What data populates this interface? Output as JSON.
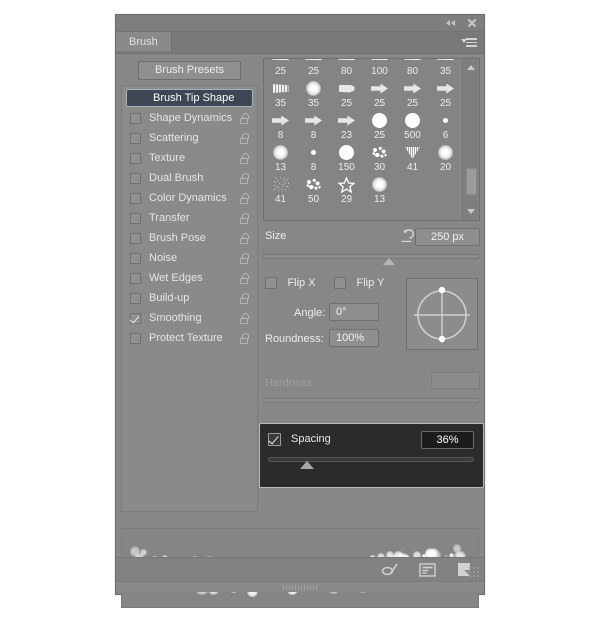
{
  "window": {
    "collapse_icon": "collapse-double-arrow-icon",
    "close_icon": "close-icon",
    "menu_icon": "panel-menu-icon"
  },
  "tabs": [
    {
      "label": "Brush",
      "active": true
    }
  ],
  "left": {
    "presets_button": "Brush Presets",
    "selected_option": "Brush Tip Shape",
    "options": [
      {
        "label": "Shape Dynamics",
        "checked": false,
        "locked": true
      },
      {
        "label": "Scattering",
        "checked": false,
        "locked": true
      },
      {
        "label": "Texture",
        "checked": false,
        "locked": true
      },
      {
        "label": "Dual Brush",
        "checked": false,
        "locked": true
      },
      {
        "label": "Color Dynamics",
        "checked": false,
        "locked": true
      },
      {
        "label": "Transfer",
        "checked": false,
        "locked": true
      },
      {
        "label": "Brush Pose",
        "checked": false,
        "locked": true
      },
      {
        "label": "Noise",
        "checked": false,
        "locked": true
      },
      {
        "label": "Wet Edges",
        "checked": false,
        "locked": true
      },
      {
        "label": "Build-up",
        "checked": false,
        "locked": true
      },
      {
        "label": "Smoothing",
        "checked": true,
        "locked": true
      },
      {
        "label": "Protect Texture",
        "checked": false,
        "locked": true
      }
    ]
  },
  "brush_grid": {
    "scrollbar": "vertical-scrollbar",
    "tips": [
      {
        "size": "25",
        "shape": "chisel"
      },
      {
        "size": "25",
        "shape": "chisel"
      },
      {
        "size": "80",
        "shape": "chisel"
      },
      {
        "size": "100",
        "shape": "chisel"
      },
      {
        "size": "80",
        "shape": "chisel"
      },
      {
        "size": "35",
        "shape": "chisel"
      },
      {
        "size": "35",
        "shape": "bristle"
      },
      {
        "size": "35",
        "shape": "soft-round"
      },
      {
        "size": "25",
        "shape": "flat-fan"
      },
      {
        "size": "25",
        "shape": "cone"
      },
      {
        "size": "25",
        "shape": "cone"
      },
      {
        "size": "25",
        "shape": "cone"
      },
      {
        "size": "8",
        "shape": "cone"
      },
      {
        "size": "8",
        "shape": "cone"
      },
      {
        "size": "23",
        "shape": "cone"
      },
      {
        "size": "25",
        "shape": "hard-round"
      },
      {
        "size": "500",
        "shape": "hard-round"
      },
      {
        "size": "6",
        "shape": "tiny-round"
      },
      {
        "size": "13",
        "shape": "soft-round"
      },
      {
        "size": "8",
        "shape": "tiny-round"
      },
      {
        "size": "150",
        "shape": "hard-round"
      },
      {
        "size": "30",
        "shape": "spatter"
      },
      {
        "size": "41",
        "shape": "triangle-texture"
      },
      {
        "size": "20",
        "shape": "soft-round"
      },
      {
        "size": "41",
        "shape": "crack"
      },
      {
        "size": "50",
        "shape": "spatter"
      },
      {
        "size": "29",
        "shape": "star-outline"
      },
      {
        "size": "13",
        "shape": "soft-round"
      }
    ]
  },
  "controls": {
    "size": {
      "label": "Size",
      "value": "250 px",
      "revert_icon": "revert-arrow-icon",
      "slider_percent": 58
    },
    "flip_x": {
      "label": "Flip X",
      "checked": false
    },
    "flip_y": {
      "label": "Flip Y",
      "checked": false
    },
    "angle": {
      "label": "Angle:",
      "value": "0°"
    },
    "roundness": {
      "label": "Roundness:",
      "value": "100%"
    },
    "hardness": {
      "label": "Hardness",
      "value": "",
      "disabled": true
    },
    "angle_pad": "angle-roundness-control",
    "spacing": {
      "label": "Spacing",
      "checked": true,
      "value": "36%",
      "slider_percent": 16
    }
  },
  "preview": {
    "name": "brush-stroke-preview"
  },
  "toolbar": {
    "icons": [
      {
        "name": "toggle-live-tip-brush-preview-icon"
      },
      {
        "name": "open-preset-manager-icon"
      },
      {
        "name": "create-new-brush-icon"
      }
    ],
    "resize_grip": "resize-grip",
    "bottom_grip": "panel-drag-grip"
  }
}
